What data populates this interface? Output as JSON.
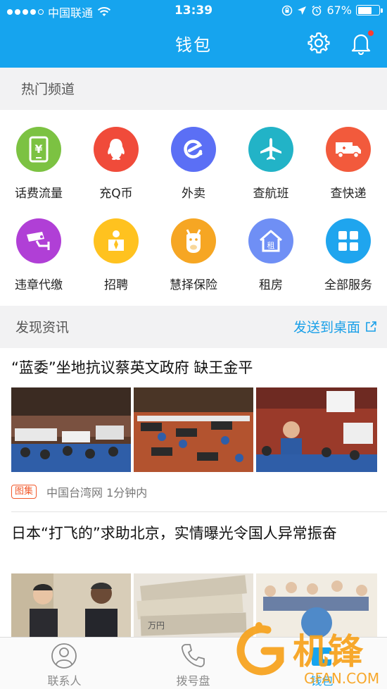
{
  "status_bar": {
    "carrier": "中国联通",
    "time": "13:39",
    "battery": "67%",
    "battery_level": 0.67
  },
  "header": {
    "title": "钱包",
    "settings_icon": "gear-icon",
    "notification_icon": "bell-icon"
  },
  "hot_channels": {
    "label": "热门频道",
    "items": [
      {
        "label": "话费流量",
        "icon": "phone-bill-icon",
        "color": "#7cc242"
      },
      {
        "label": "充Q币",
        "icon": "qq-penguin-icon",
        "color": "#f04b3a"
      },
      {
        "label": "外卖",
        "icon": "eleme-icon",
        "color": "#5b6ff5"
      },
      {
        "label": "查航班",
        "icon": "airplane-icon",
        "color": "#22b3c7"
      },
      {
        "label": "查快递",
        "icon": "delivery-truck-icon",
        "color": "#f25a3c"
      },
      {
        "label": "违章代缴",
        "icon": "traffic-camera-icon",
        "color": "#b03fd6"
      },
      {
        "label": "招聘",
        "icon": "job-icon",
        "color": "#ffc21f"
      },
      {
        "label": "慧择保险",
        "icon": "insurance-horse-icon",
        "color": "#f6a623"
      },
      {
        "label": "租房",
        "icon": "rent-house-icon",
        "color": "#6f8ff5"
      },
      {
        "label": "全部服务",
        "icon": "all-services-icon",
        "color": "#1fa5ee"
      }
    ]
  },
  "discover": {
    "label": "发现资讯",
    "send_to_desktop": "发送到桌面",
    "articles": [
      {
        "headline": "“蓝委”坐地抗议蔡英文政府 缺王金平",
        "tag": "图集",
        "source": "中国台湾网",
        "time": "1分钟内"
      },
      {
        "headline": "日本“打飞的”求助北京，实情曝光令国人异常振奋"
      }
    ]
  },
  "tab_bar": {
    "tabs": [
      {
        "label": "联系人",
        "icon": "contacts-icon"
      },
      {
        "label": "拨号盘",
        "icon": "phone-icon"
      },
      {
        "label": "钱包",
        "icon": "wallet-icon"
      }
    ]
  },
  "watermark": {
    "brand": "机锋",
    "domain": "GFAN.COM"
  }
}
